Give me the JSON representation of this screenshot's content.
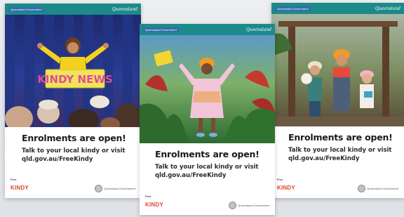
{
  "posters": [
    {
      "program_tag": "Queensland Government",
      "gov_mark": "Queensland",
      "headline": "Enrolments are open!",
      "line1": "Talk to your local kindy or visit",
      "line2": "qld.gov.au/FreeKindy",
      "logo_free": "Free",
      "logo_kindy": "KINDY",
      "crest_name": "Queensland Government",
      "sign_text": "KINDY NEWS"
    },
    {
      "program_tag": "Queensland Government",
      "gov_mark": "Queensland",
      "headline": "Enrolments are open!",
      "line1": "Talk to your local kindy or visit",
      "line2": "qld.gov.au/FreeKindy",
      "logo_free": "Free",
      "logo_kindy": "KINDY",
      "crest_name": "Queensland Government"
    },
    {
      "program_tag": "Queensland Government",
      "gov_mark": "Queensland",
      "headline": "Enrolments are open!",
      "line1": "Talk to your local kindy or visit",
      "line2": "qld.gov.au/FreeKindy",
      "logo_free": "Free",
      "logo_kindy": "KINDY",
      "crest_name": "Queensland Government"
    }
  ],
  "colors": {
    "teal_band": "#1d8a8a",
    "background": "#e4e7ea",
    "headline": "#1a1a1a"
  }
}
